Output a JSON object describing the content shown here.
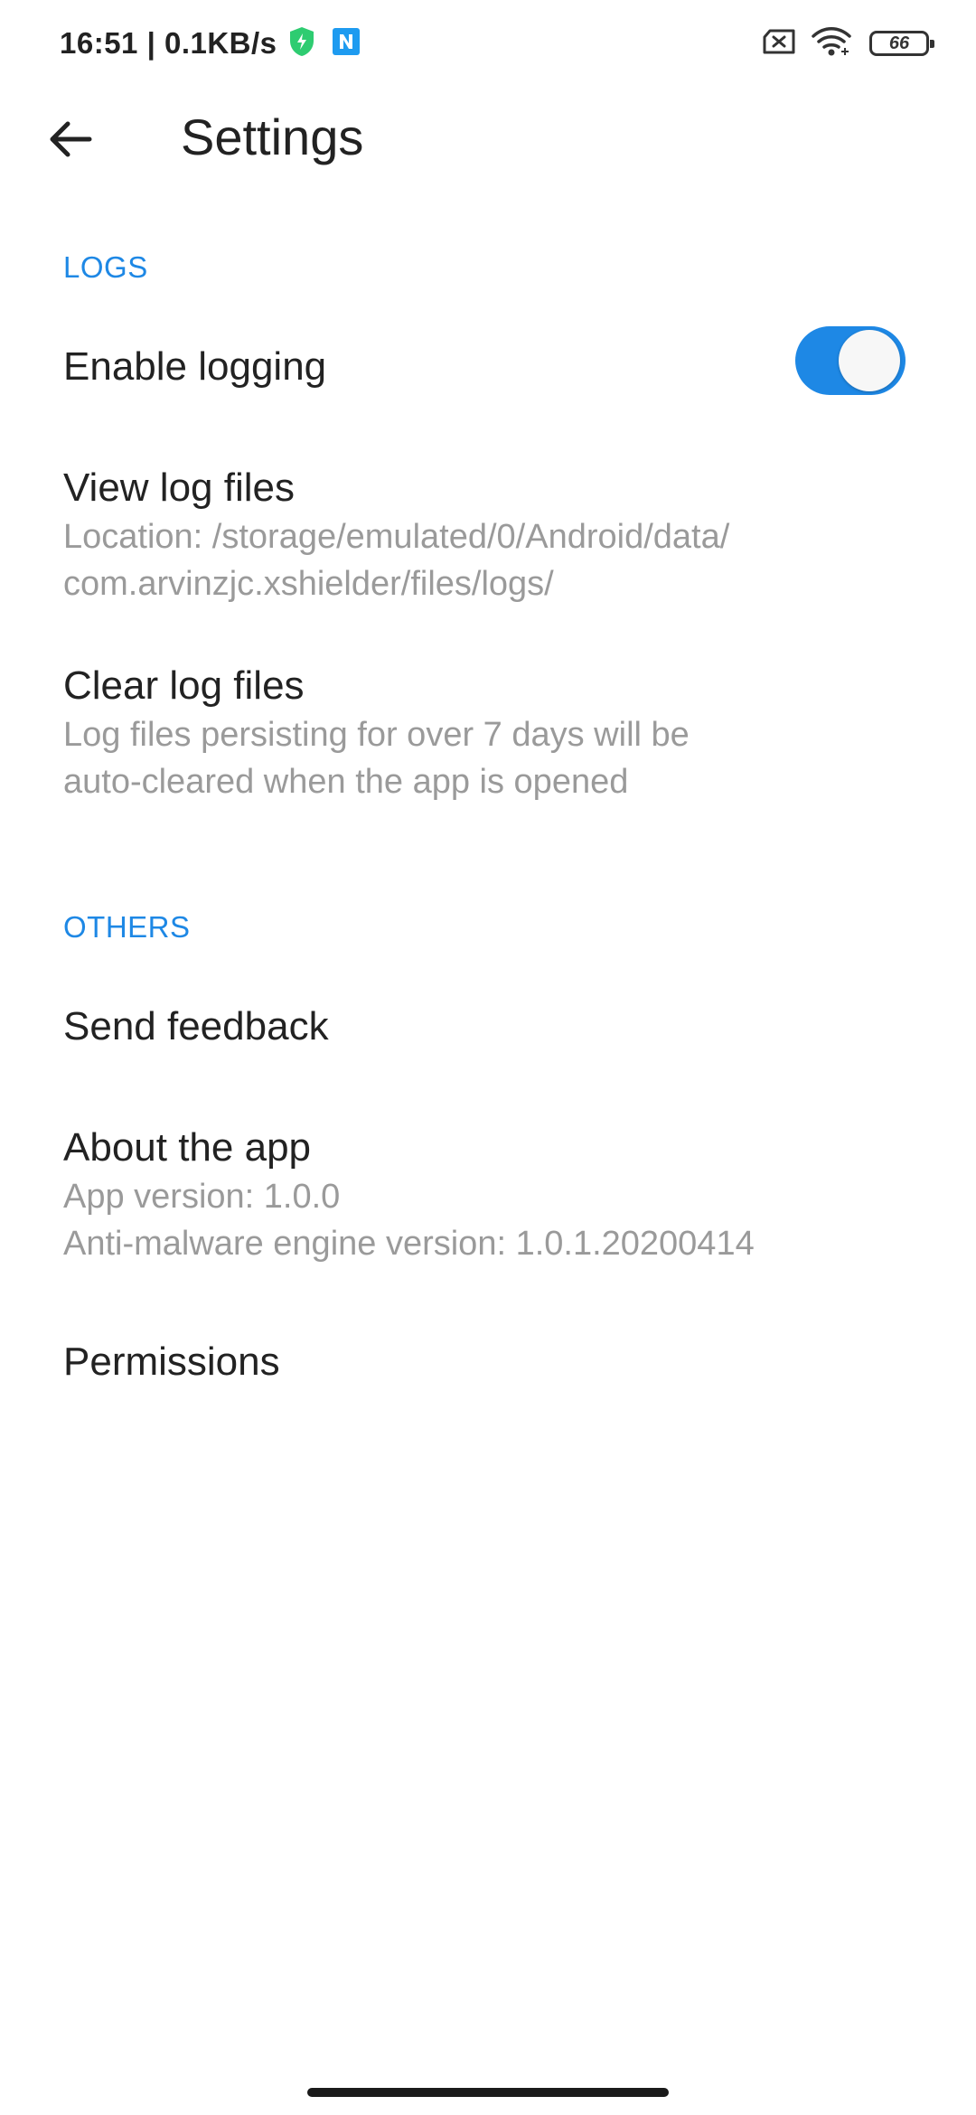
{
  "status_bar": {
    "time": "16:51 | 0.1KB/s",
    "battery_level": "66",
    "icons": [
      "shield-bolt-icon",
      "n-app-icon",
      "sim-blocked-icon",
      "wifi-icon",
      "battery-icon"
    ],
    "shield_color": "#2ecc71",
    "n_app_color": "#1e9bf0"
  },
  "app_bar": {
    "back_icon": "arrow-left-icon",
    "title": "Settings"
  },
  "sections": {
    "logs": {
      "header": "LOGS",
      "enable_logging": {
        "title": "Enable logging",
        "enabled": true
      },
      "view_log_files": {
        "title": "View log files",
        "summary_line1": "Location: /storage/emulated/0/Android/data/",
        "summary_line2": "com.arvinzjc.xshielder/files/logs/"
      },
      "clear_log_files": {
        "title": "Clear log files",
        "summary_line1": "Log files persisting for over 7 days will be",
        "summary_line2": "auto-cleared when the app is opened"
      }
    },
    "others": {
      "header": "OTHERS",
      "send_feedback": {
        "title": "Send feedback"
      },
      "about_app": {
        "title": "About the app",
        "summary_line1": "App version: 1.0.0",
        "summary_line2": "Anti-malware engine version: 1.0.1.20200414"
      },
      "permissions": {
        "title": "Permissions"
      }
    }
  },
  "colors": {
    "accent": "#1e88e5",
    "summary_text": "#9a9a9a",
    "title_text": "#222222"
  }
}
